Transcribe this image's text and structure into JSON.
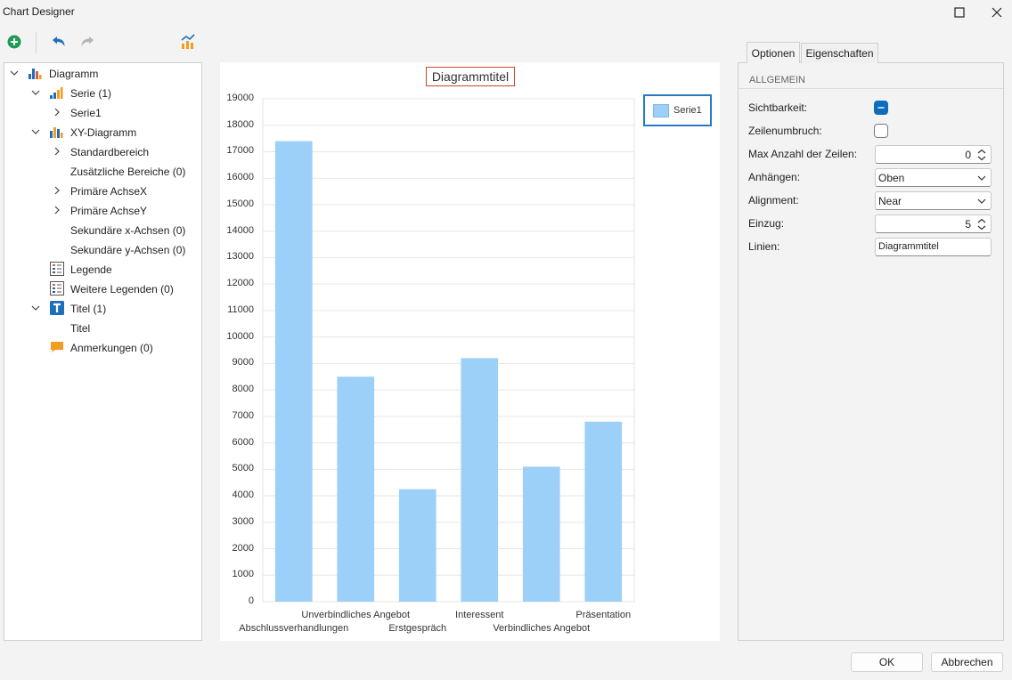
{
  "window": {
    "title": "Chart Designer"
  },
  "toolbar": {
    "add_icon": "plus-circle-icon",
    "undo_icon": "undo-icon",
    "redo_icon": "redo-icon",
    "wizard_icon": "chart-wizard-icon"
  },
  "tree": {
    "items": [
      {
        "label": "Diagramm",
        "icon": "bar-chart-icon",
        "expanded": true
      },
      {
        "label": "Serie (1)",
        "icon": "series-icon",
        "expanded": true
      },
      {
        "label": "Serie1",
        "expanded": false
      },
      {
        "label": "XY-Diagramm",
        "icon": "xy-diagram-icon",
        "expanded": true
      },
      {
        "label": "Standardbereich",
        "expanded": false
      },
      {
        "label": "Zusätzliche Bereiche (0)"
      },
      {
        "label": "Primäre AchseX",
        "expanded": false
      },
      {
        "label": "Primäre AchseY",
        "expanded": false
      },
      {
        "label": "Sekundäre x-Achsen (0)"
      },
      {
        "label": "Sekundäre y-Achsen (0)"
      },
      {
        "label": "Legende",
        "icon": "legend-icon"
      },
      {
        "label": "Weitere Legenden (0)",
        "icon": "legend-icon"
      },
      {
        "label": "Titel (1)",
        "icon": "title-icon",
        "expanded": true
      },
      {
        "label": "Titel"
      },
      {
        "label": "Anmerkungen (0)",
        "icon": "annotation-icon"
      }
    ]
  },
  "chart_data": {
    "type": "bar",
    "title": "Diagrammtitel",
    "categories": [
      "Abschlussverhandlungen",
      "Unverbindliches Angebot",
      "Erstgespräch",
      "Interessent",
      "Verbindliches Angebot",
      "Präsentation"
    ],
    "series": [
      {
        "name": "Serie1",
        "values": [
          17400,
          8500,
          4250,
          9200,
          5100,
          6800
        ],
        "color": "#9dd0f8"
      }
    ],
    "ylim": [
      0,
      19000
    ],
    "yticks": [
      0,
      1000,
      2000,
      3000,
      4000,
      5000,
      6000,
      7000,
      8000,
      9000,
      10000,
      11000,
      12000,
      13000,
      14000,
      15000,
      16000,
      17000,
      18000,
      19000
    ],
    "grid": true,
    "legend_position": "top-right"
  },
  "tabs": [
    {
      "label": "Optionen",
      "active": true
    },
    {
      "label": "Eigenschaften",
      "active": false
    }
  ],
  "props": {
    "section": "ALLGEMEIN",
    "sichtbarkeit_label": "Sichtbarkeit:",
    "sichtbarkeit_checked": true,
    "zeilenumbruch_label": "Zeilenumbruch:",
    "zeilenumbruch_checked": false,
    "max_zeilen_label": "Max Anzahl der Zeilen:",
    "max_zeilen_value": "0",
    "anhaengen_label": "Anhängen:",
    "anhaengen_value": "Oben",
    "alignment_label": "Alignment:",
    "alignment_value": "Near",
    "einzug_label": "Einzug:",
    "einzug_value": "5",
    "linien_label": "Linien:",
    "linien_value": "Diagrammtitel"
  },
  "footer": {
    "ok_label": "OK",
    "cancel_label": "Abbrechen"
  },
  "colors": {
    "accent": "#0f6cbd",
    "bar": "#9dd0f8",
    "title_border": "#c9472a",
    "legend_border": "#2b78c6"
  }
}
